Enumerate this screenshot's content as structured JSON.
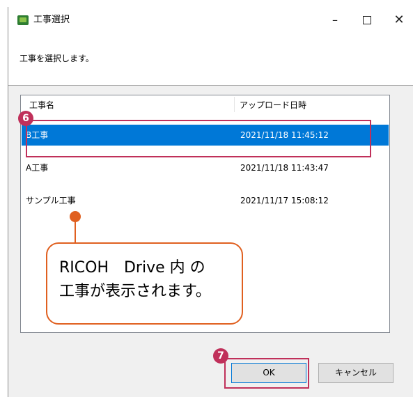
{
  "window": {
    "title": "工事選択",
    "minimize": "–",
    "close": "✕"
  },
  "instruction": "工事を選択します。",
  "list": {
    "columns": [
      "工事名",
      "アップロード日時"
    ],
    "rows": [
      {
        "name": "B工事",
        "date": "2021/11/18 11:45:12",
        "selected": true
      },
      {
        "name": "A工事",
        "date": "2021/11/18 11:43:47",
        "selected": false
      },
      {
        "name": "サンプル工事",
        "date": "2021/11/17 15:08:12",
        "selected": false
      }
    ]
  },
  "annotations": {
    "step6": "6",
    "step7": "7",
    "callout_line1": "RICOH　Drive 内 の",
    "callout_line2": "工事が表示されます。",
    "highlight_color": "#c0305a",
    "callout_color": "#e06020"
  },
  "buttons": {
    "ok": "OK",
    "cancel": "キャンセル"
  },
  "colors": {
    "selection": "#0078d7"
  }
}
